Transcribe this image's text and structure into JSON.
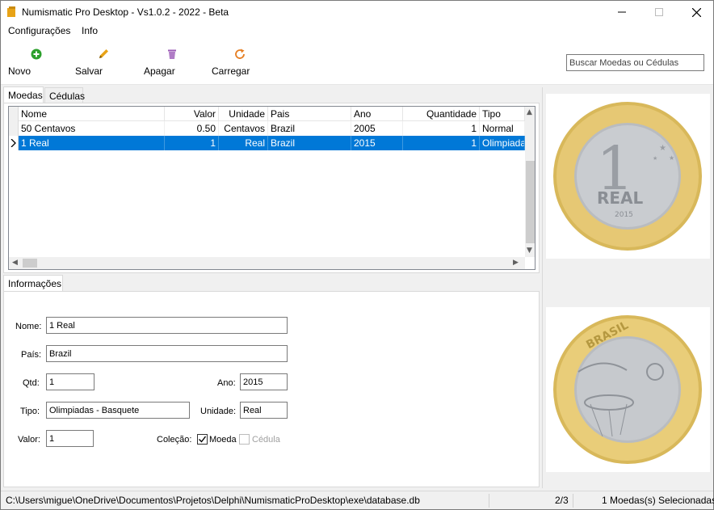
{
  "window": {
    "title": "Numismatic Pro Desktop - Vs1.0.2 - 2022 - Beta",
    "controls": [
      "minimize-icon",
      "maximize-icon",
      "close-icon"
    ]
  },
  "menu": {
    "items": [
      {
        "label": "Configurações"
      },
      {
        "label": "Info"
      }
    ]
  },
  "toolbar": {
    "buttons": [
      {
        "label": "Novo",
        "icon": "plus-circle-icon",
        "color": "#2ca02c"
      },
      {
        "label": "Salvar",
        "icon": "pencil-icon",
        "color": "#e8a317"
      },
      {
        "label": "Apagar",
        "icon": "trash-icon",
        "color": "#9b59b6"
      },
      {
        "label": "Carregar",
        "icon": "refresh-icon",
        "color": "#e67e22"
      }
    ],
    "search_placeholder": "Buscar Moedas ou Cédulas"
  },
  "tabs": {
    "items": [
      {
        "label": "Moedas",
        "active": true
      },
      {
        "label": "Cédulas",
        "active": false
      }
    ]
  },
  "grid": {
    "columns": [
      "Nome",
      "Valor",
      "Unidade",
      "Pais",
      "Ano",
      "Quantidade",
      "Tipo"
    ],
    "rows": [
      {
        "nome": "50 Centavos",
        "valor": "0.50",
        "unidade": "Centavos",
        "pais": "Brazil",
        "ano": "2005",
        "quantidade": "1",
        "tipo": "Normal",
        "selected": false
      },
      {
        "nome": "1 Real",
        "valor": "1",
        "unidade": "Real",
        "pais": "Brazil",
        "ano": "2015",
        "quantidade": "1",
        "tipo": "Olimpiadas",
        "selected": true
      }
    ],
    "selection_color": "#0078d7"
  },
  "info": {
    "tab_label": "Informações",
    "labels": {
      "nome": "Nome:",
      "pais": "País:",
      "qtd": "Qtd:",
      "ano": "Ano:",
      "tipo": "Tipo:",
      "unidade": "Unidade:",
      "valor": "Valor:",
      "colecao": "Coleção:",
      "moeda": "Moeda",
      "cedula": "Cédula"
    },
    "values": {
      "nome": "1 Real",
      "pais": "Brazil",
      "qtd": "1",
      "ano": "2015",
      "tipo": "Olimpiadas - Basquete",
      "unidade": "Real",
      "valor": "1"
    },
    "moeda_checked": true,
    "cedula_checked": false
  },
  "images": {
    "obverse_text": "1 REAL 2015",
    "reverse_text": "BRASIL"
  },
  "statusbar": {
    "path": "C:\\Users\\migue\\OneDrive\\Documentos\\Projetos\\Delphi\\NumismaticProDesktop\\exe\\database.db",
    "position": "2/3",
    "selection": "1 Moedas(s) Selecionadas"
  }
}
